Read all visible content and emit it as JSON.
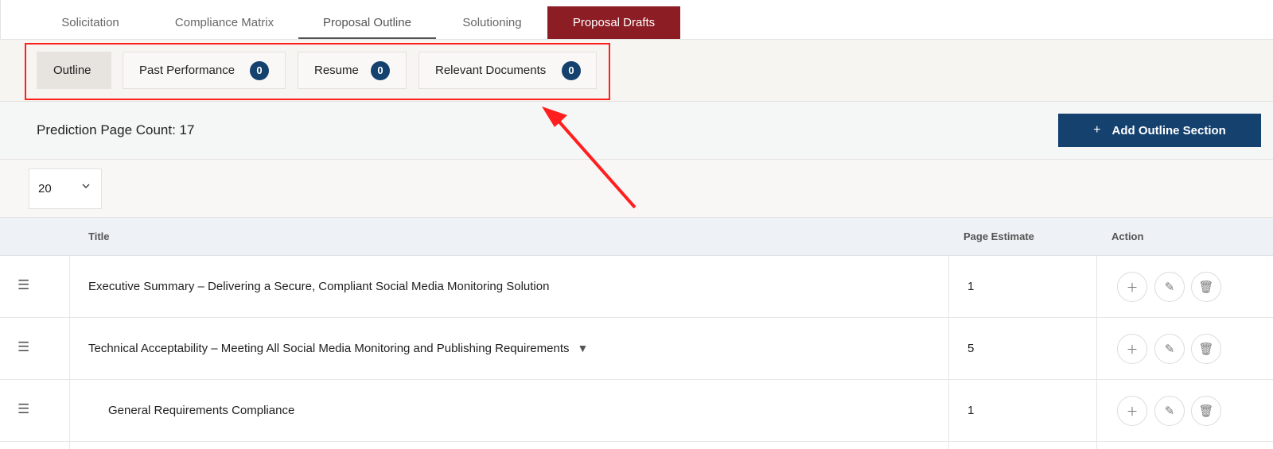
{
  "top_tabs": {
    "solicitation": "Solicitation",
    "compliance_matrix": "Compliance Matrix",
    "proposal_outline": "Proposal Outline",
    "solutioning": "Solutioning",
    "proposal_drafts": "Proposal Drafts"
  },
  "sub_tabs": {
    "outline": "Outline",
    "past_performance": {
      "label": "Past Performance",
      "count": "0"
    },
    "resume": {
      "label": "Resume",
      "count": "0"
    },
    "relevant_documents": {
      "label": "Relevant Documents",
      "count": "0"
    }
  },
  "prediction": {
    "text": "Prediction Page Count: 17"
  },
  "add_button": {
    "icon": "+",
    "label": "Add Outline Section"
  },
  "page_size": {
    "value": "20"
  },
  "table": {
    "headers": {
      "title": "Title",
      "page_estimate": "Page Estimate",
      "action": "Action"
    },
    "rows": [
      {
        "title": "Executive Summary – Delivering a Secure, Compliant Social Media Monitoring Solution",
        "estimate": "1"
      },
      {
        "title": "Technical Acceptability – Meeting All Social Media Monitoring and Publishing Requirements",
        "estimate": "5"
      },
      {
        "title": "General Requirements Compliance",
        "estimate": "1"
      }
    ]
  },
  "colors": {
    "brand_red": "#8c1d24",
    "brand_navy": "#14416e",
    "highlight_red": "#ff1f1f"
  }
}
